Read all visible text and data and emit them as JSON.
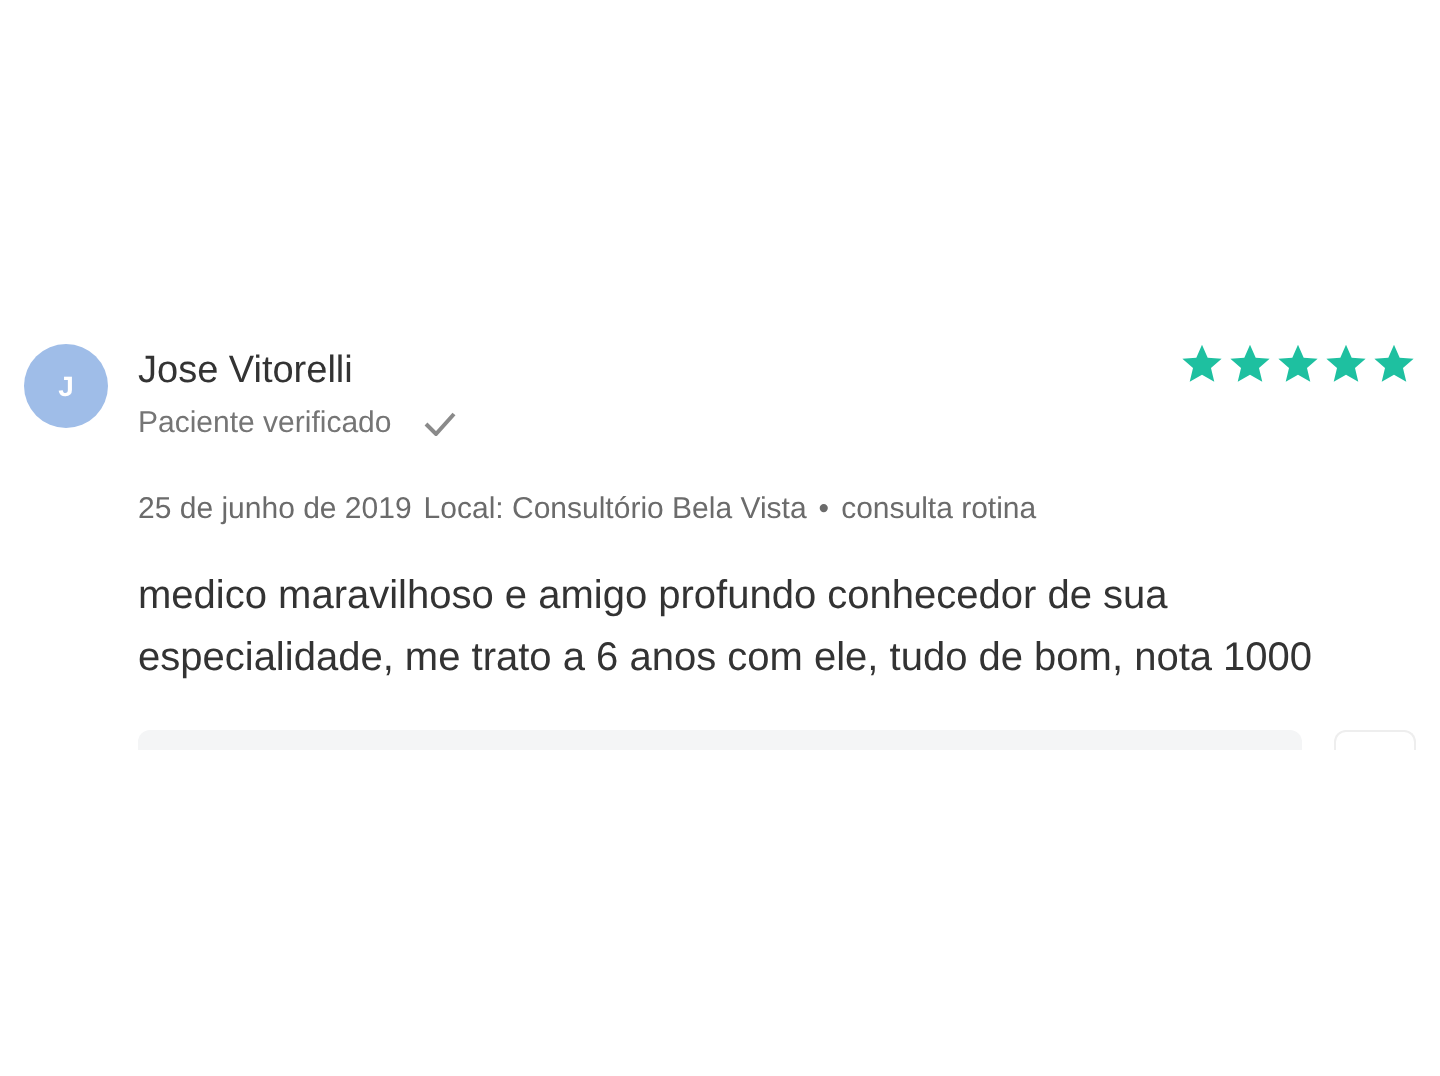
{
  "review": {
    "avatar_initial": "J",
    "author": "Jose Vitorelli",
    "verified": "Paciente verificado",
    "stars": 5,
    "date": "25 de junho de 2019",
    "location": "Local: Consultório Bela Vista",
    "separator": "•",
    "visit_type": "consulta rotina",
    "text": "medico maravilhoso e amigo profundo conhecedor de sua especialidade, me trato a 6 anos com ele, tudo de bom, nota 1000"
  }
}
